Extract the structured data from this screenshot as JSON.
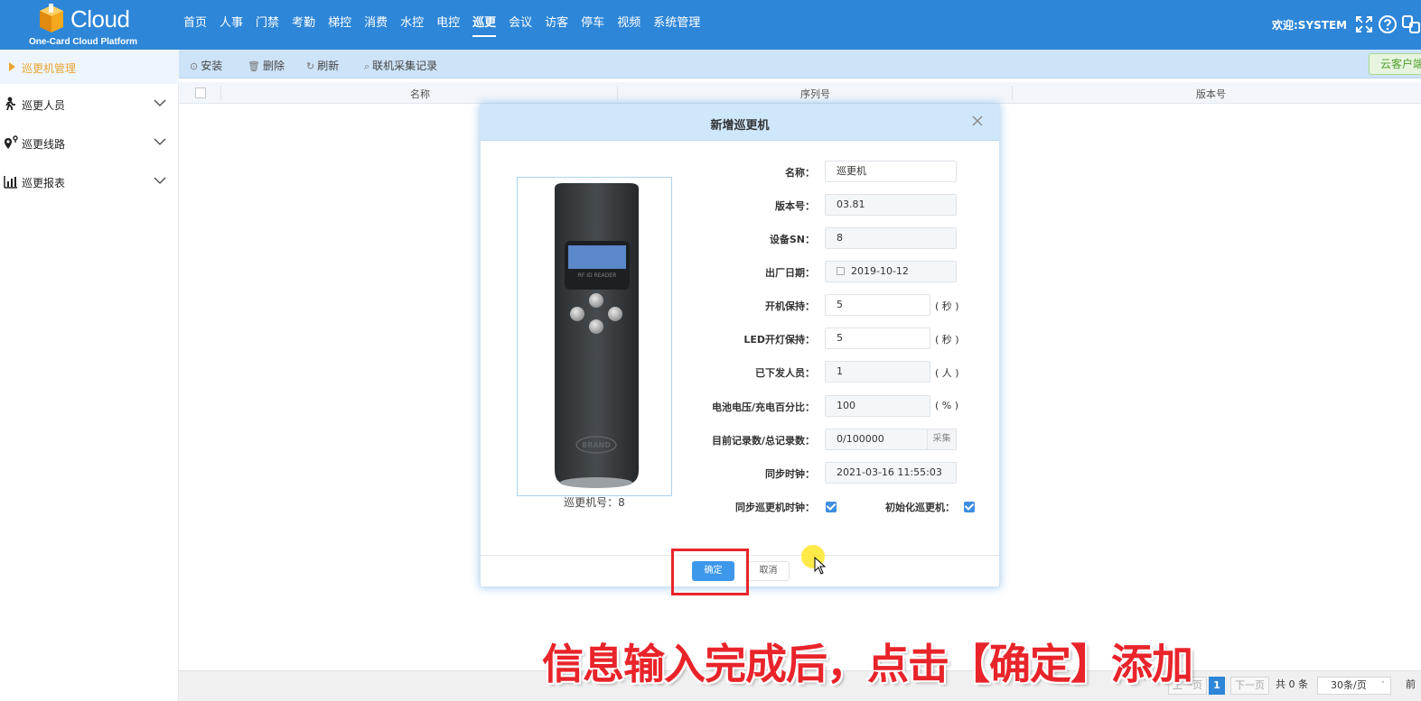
{
  "logo": {
    "word": "Cloud",
    "sub": "One-Card Cloud Platform"
  },
  "nav": {
    "items": [
      "首页",
      "人事",
      "门禁",
      "考勤",
      "梯控",
      "消费",
      "水控",
      "电控",
      "巡更",
      "会议",
      "访客",
      "停车",
      "视频",
      "系统管理"
    ],
    "active": "巡更"
  },
  "header": {
    "welcome": "欢迎:SYSTEM"
  },
  "sidebar": {
    "active": "巡更机管理",
    "items": [
      {
        "label": "巡更人员",
        "icon": "person-walk-icon"
      },
      {
        "label": "巡更线路",
        "icon": "route-pin-icon"
      },
      {
        "label": "巡更报表",
        "icon": "bar-chart-icon"
      }
    ]
  },
  "toolbar": {
    "install": "安装",
    "delete": "删除",
    "refresh": "刷新",
    "records": "联机采集记录",
    "cloud": "云客户端"
  },
  "table": {
    "columns": [
      "名称",
      "序列号",
      "版本号"
    ]
  },
  "pagination": {
    "prev": "上一页",
    "current": "1",
    "next": "下一页",
    "total": "共 0 条",
    "per_page": "30条/页",
    "extra": "前"
  },
  "modal": {
    "title": "新增巡更机",
    "device_caption": "巡更机号：8",
    "fields": {
      "name_label": "名称：",
      "name_value": "巡更机",
      "version_label": "版本号：",
      "version_value": "03.81",
      "sn_label": "设备SN：",
      "sn_value": "8",
      "date_label": "出厂日期：",
      "date_value": "2019-10-12",
      "boot_label": "开机保持：",
      "boot_value": "5",
      "boot_unit": "( 秒 )",
      "led_label": "LED开灯保持：",
      "led_value": "5",
      "led_unit": "( 秒 )",
      "issued_label": "已下发人员：",
      "issued_value": "1",
      "issued_unit": "( 人 )",
      "battery_label": "电池电压/充电百分比：",
      "battery_value": "100",
      "battery_unit": "( % )",
      "records_label": "目前记录数/总记录数：",
      "records_value": "0/100000",
      "collect": "采集",
      "clock_label": "同步时钟：",
      "clock_value": "2021-03-16 11:55:03",
      "sync_label": "同步巡更机时钟：",
      "init_label": "初始化巡更机："
    },
    "ok": "确定",
    "cancel": "取消"
  },
  "device": {
    "screen_text": "RF ID READER",
    "brand": "BRAND"
  },
  "caption": "信息输入完成后，点击【确定】添加"
}
